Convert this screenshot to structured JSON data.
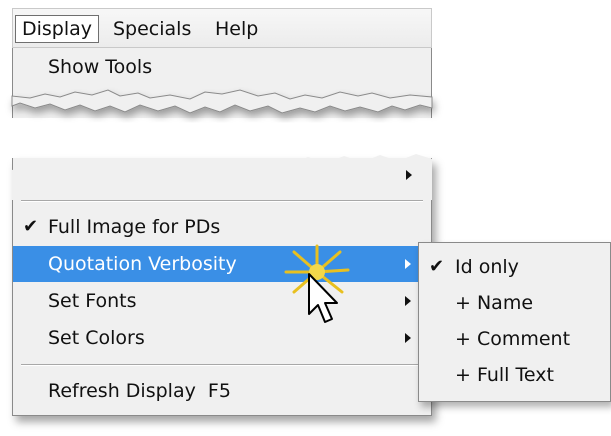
{
  "menubar": {
    "items": [
      "Display",
      "Specials",
      "Help"
    ],
    "active": "Display"
  },
  "top_menu": {
    "show_tools": "Show Tools"
  },
  "display_menu": {
    "items": [
      {
        "label": "Full Image for PDs",
        "checked": true,
        "submenu": false
      },
      {
        "label": "Quotation Verbosity",
        "checked": false,
        "submenu": true,
        "highlighted": true
      },
      {
        "label": "Set Fonts",
        "checked": false,
        "submenu": true
      },
      {
        "label": "Set Colors",
        "checked": false,
        "submenu": true
      },
      {
        "label": "Refresh Display  F5",
        "checked": false,
        "submenu": false
      }
    ]
  },
  "verbosity_submenu": {
    "items": [
      {
        "label": "Id only",
        "checked": true
      },
      {
        "label": "+ Name",
        "checked": false
      },
      {
        "label": "+ Comment",
        "checked": false
      },
      {
        "label": "+ Full Text",
        "checked": false
      }
    ]
  },
  "colors": {
    "highlight": "#3a8fe6",
    "menu_bg": "#f0f0f0",
    "starburst": "#e8c020"
  },
  "icons": [
    "check-icon",
    "submenu-arrow-icon",
    "mouse-cursor-icon",
    "click-starburst-icon"
  ]
}
